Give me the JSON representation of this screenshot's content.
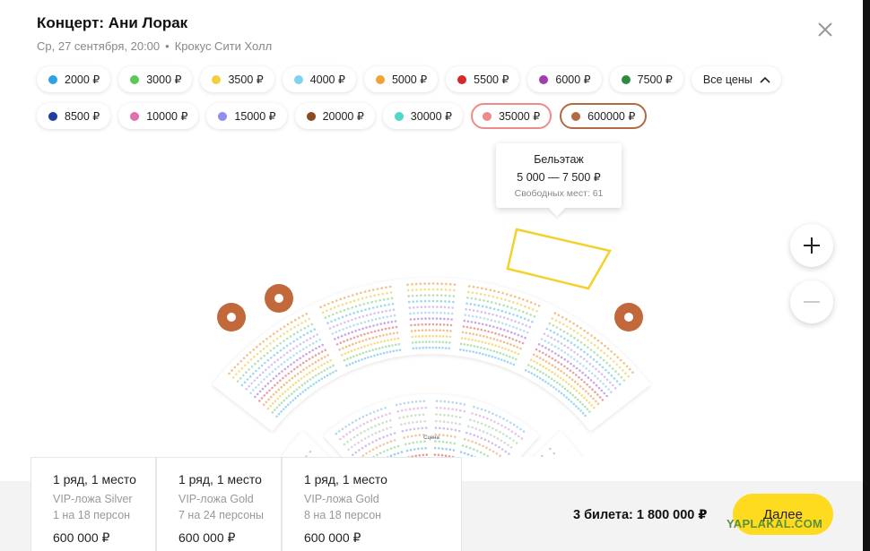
{
  "header": {
    "title": "Концерт: Ани Лорак",
    "date": "Ср, 27 сентября, 20:00",
    "separator": "•",
    "venue": "Крокус Сити Холл"
  },
  "price_filters": {
    "row1": [
      {
        "label": "2000 ₽",
        "color": "#2ea3e3"
      },
      {
        "label": "3000 ₽",
        "color": "#5ac95a"
      },
      {
        "label": "3500 ₽",
        "color": "#f2cf3f"
      },
      {
        "label": "4000 ₽",
        "color": "#7fd3f2"
      },
      {
        "label": "5000 ₽",
        "color": "#f2a23a"
      },
      {
        "label": "5500 ₽",
        "color": "#d42a2a"
      },
      {
        "label": "6000 ₽",
        "color": "#a23cb0"
      },
      {
        "label": "7500 ₽",
        "color": "#2e8b3e"
      }
    ],
    "all_prices_label": "Все цены",
    "row2": [
      {
        "label": "8500 ₽",
        "color": "#1f3f9e"
      },
      {
        "label": "10000 ₽",
        "color": "#e070b0"
      },
      {
        "label": "15000 ₽",
        "color": "#8e8ef0"
      },
      {
        "label": "20000 ₽",
        "color": "#8a4a22"
      },
      {
        "label": "30000 ₽",
        "color": "#4dd8c8"
      },
      {
        "label": "35000 ₽",
        "color": "#f08a8a"
      },
      {
        "label": "600000 ₽",
        "color": "#b26a42"
      }
    ]
  },
  "tooltip": {
    "section": "Бельэтаж",
    "price_range": "5 000 — 7 500 ₽",
    "free_seats": "Свободных мест: 61"
  },
  "map_labels": {
    "stage": "Сцена"
  },
  "tickets": [
    {
      "seat": "1 ряд, 1 место",
      "zone": "VIP-ложа Silver",
      "capacity": "1 на 18 персон",
      "price": "600 000 ₽"
    },
    {
      "seat": "1 ряд, 1 место",
      "zone": "VIP-ложа Gold",
      "capacity": "7 на 24 персоны",
      "price": "600 000 ₽"
    },
    {
      "seat": "1 ряд, 1 место",
      "zone": "VIP-ложа Gold",
      "capacity": "8 на 18 персон",
      "price": "600 000 ₽"
    }
  ],
  "summary": {
    "count_label": "3 билета:",
    "total": "1 800 000 ₽"
  },
  "next_button": "Далее",
  "watermark": "YAPLAKAL.COM"
}
